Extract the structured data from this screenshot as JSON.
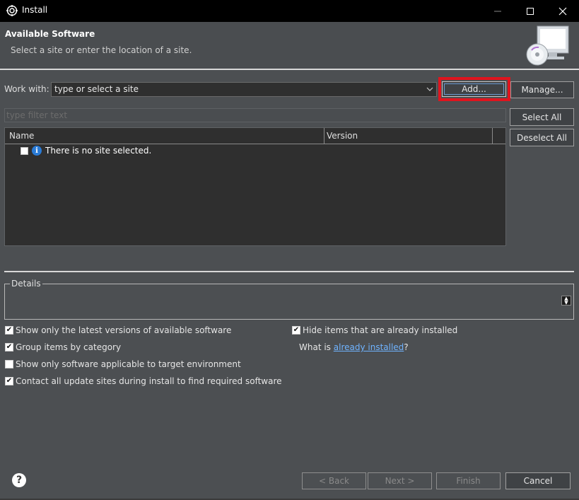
{
  "window": {
    "title": "Install",
    "min_icon": "minimize-icon",
    "max_icon": "maximize-icon",
    "close_icon": "close-icon"
  },
  "banner": {
    "title": "Available Software",
    "subtitle": "Select a site or enter the location of a site.",
    "icon": "install-monitor-cd-icon"
  },
  "workwith": {
    "label": "Work with:",
    "value": "type or select a site",
    "add_label": "Add...",
    "manage_label": "Manage..."
  },
  "filter": {
    "placeholder": "type filter text"
  },
  "table": {
    "columns": [
      "Name",
      "Version"
    ],
    "rows": [
      {
        "checked": false,
        "icon": "info-icon",
        "text": "There is no site selected."
      }
    ]
  },
  "side_buttons": {
    "select_all": "Select All",
    "deselect_all": "Deselect All"
  },
  "details": {
    "label": "Details"
  },
  "options": {
    "show_latest": {
      "label": "Show only the latest versions of available software",
      "checked": true
    },
    "group_by_category": {
      "label": "Group items by category",
      "checked": true
    },
    "show_applicable": {
      "label": "Show only software applicable to target environment",
      "checked": false
    },
    "contact_all": {
      "label": "Contact all update sites during install to find required software",
      "checked": true
    },
    "hide_installed": {
      "label": "Hide items that are already installed",
      "checked": true
    },
    "what_is_prefix": "What is ",
    "already_installed_link": "already installed",
    "what_is_suffix": "?"
  },
  "footer": {
    "help_icon": "help-icon",
    "back_label": "< Back",
    "next_label": "Next >",
    "finish_label": "Finish",
    "cancel_label": "Cancel"
  },
  "colors": {
    "highlight": "#e0141e",
    "link": "#6fb3ff",
    "background": "#4c4f52"
  }
}
